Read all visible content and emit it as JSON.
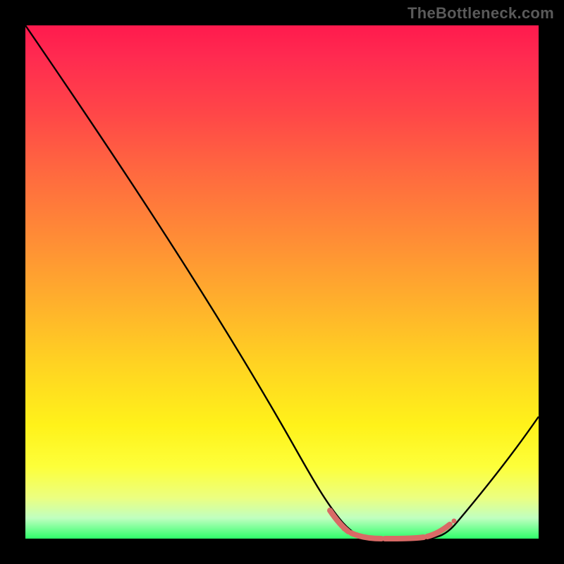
{
  "watermark": "TheBottleneck.com",
  "chart_data": {
    "type": "line",
    "title": "",
    "xlabel": "",
    "ylabel": "",
    "xlim": [
      0,
      100
    ],
    "ylim": [
      0,
      100
    ],
    "x": [
      0,
      5,
      10,
      15,
      20,
      25,
      30,
      35,
      40,
      45,
      50,
      55,
      57,
      60,
      63,
      66,
      69,
      72,
      75,
      78,
      81,
      83,
      86,
      90,
      95,
      100
    ],
    "values": [
      100,
      93,
      86,
      79,
      72,
      64.5,
      57,
      49,
      41,
      33,
      24.5,
      15,
      11,
      6,
      3,
      1.2,
      0.6,
      0.4,
      0.4,
      0.6,
      1.2,
      2.2,
      4.5,
      9,
      16,
      24
    ],
    "marker_points_x": [
      57,
      60,
      62,
      65,
      68,
      70,
      73,
      76,
      79,
      82,
      84
    ],
    "marker_points_y": [
      11,
      6,
      4,
      2,
      1,
      0.6,
      0.4,
      0.5,
      0.8,
      1.6,
      2.6
    ],
    "marker_color": "#d96a66",
    "line_color": "#000000",
    "gradient_stops": [
      {
        "pos": 0.0,
        "color": "#ff1a4d"
      },
      {
        "pos": 0.5,
        "color": "#ffb02c"
      },
      {
        "pos": 0.85,
        "color": "#fdff3a"
      },
      {
        "pos": 1.0,
        "color": "#2fff6a"
      }
    ]
  }
}
